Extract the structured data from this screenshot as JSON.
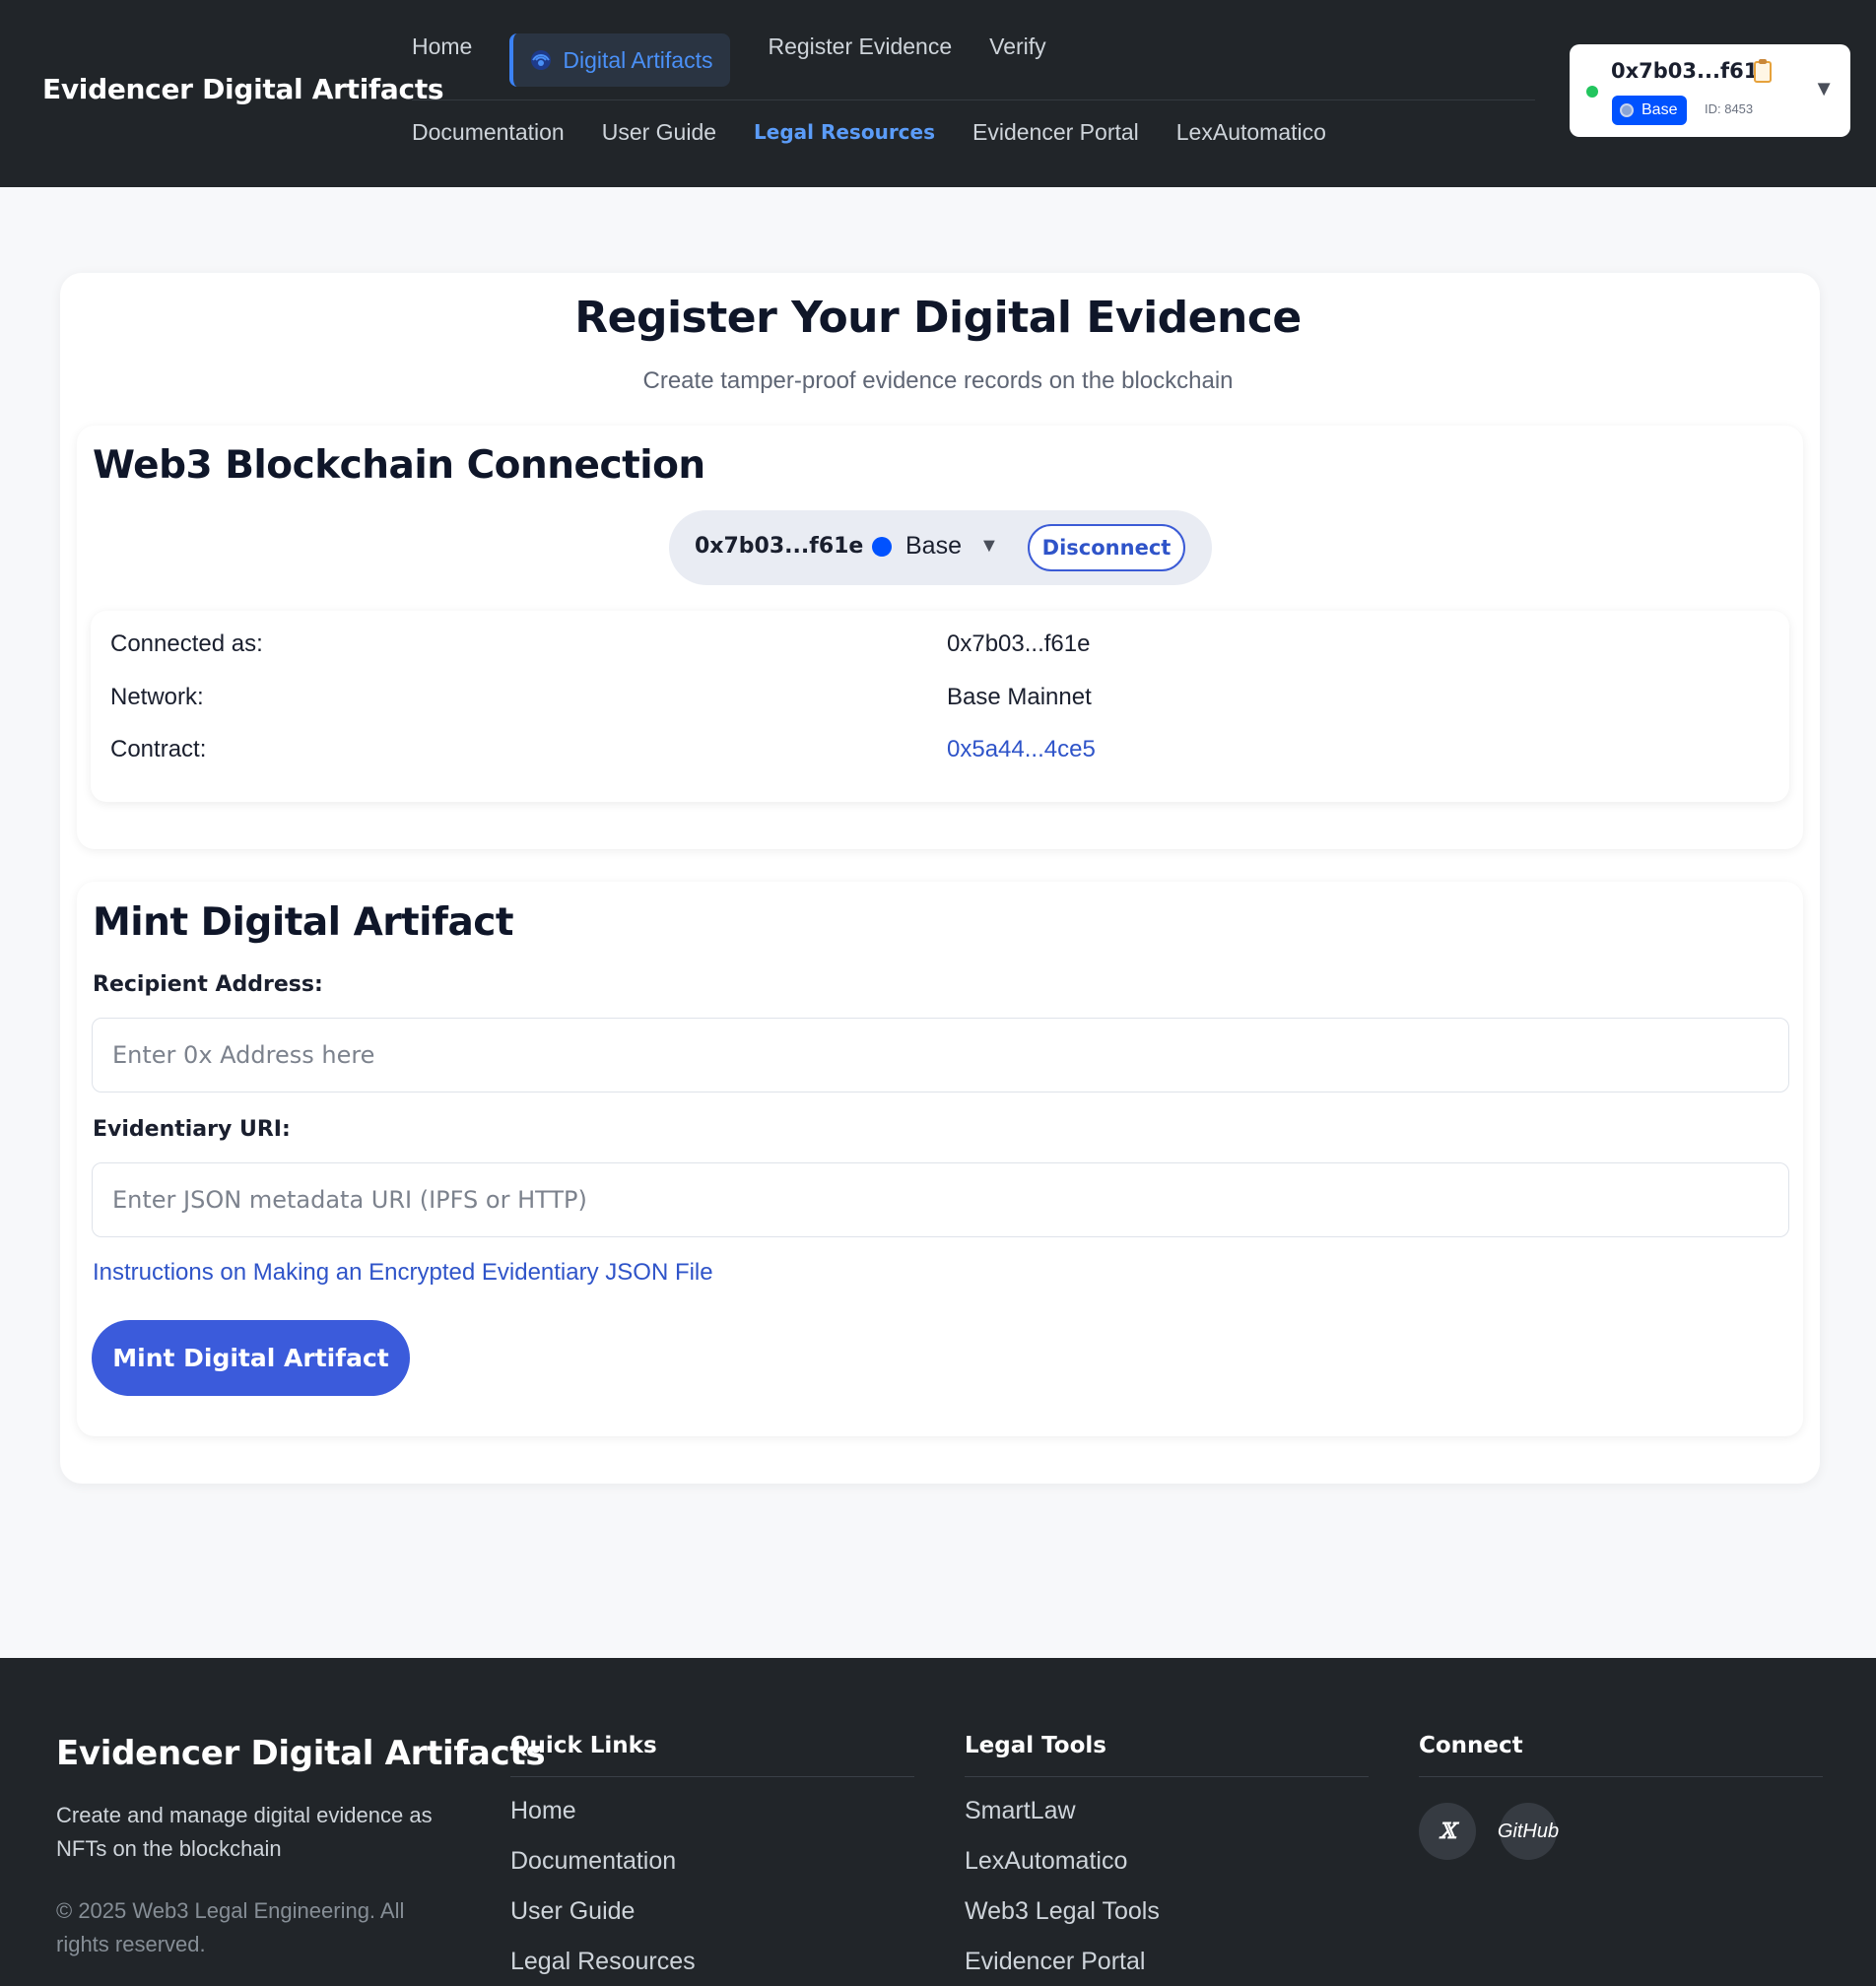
{
  "header": {
    "brand": "Evidencer Digital Artifacts",
    "nav_primary": [
      {
        "label": "Home"
      },
      {
        "label": "Digital Artifacts",
        "icon": "eye-icon",
        "active": true
      },
      {
        "label": "Register Evidence"
      },
      {
        "label": "Verify"
      }
    ],
    "nav_secondary": [
      {
        "label": "Documentation"
      },
      {
        "label": "User Guide"
      },
      {
        "label": "Legal Resources",
        "highlight": true
      },
      {
        "label": "Evidencer Portal"
      },
      {
        "label": "LexAutomatico"
      }
    ],
    "wallet": {
      "address": "0x7b03...f61e",
      "network": "Base",
      "chain_id": "ID: 8453",
      "status": "connected",
      "status_color": "#22c55e"
    }
  },
  "main": {
    "title": "Register Your Digital Evidence",
    "subtitle": "Create tamper-proof evidence records on the blockchain",
    "connection": {
      "title": "Web3 Blockchain Connection",
      "pill": {
        "address": "0x7b03...f61e",
        "network": "Base",
        "network_color": "#0052ff",
        "disconnect_label": "Disconnect"
      },
      "info": {
        "connected_label": "Connected as:",
        "connected_value": "0x7b03...f61e",
        "network_label": "Network:",
        "network_value": "Base Mainnet",
        "contract_label": "Contract:",
        "contract_value": "0x5a44...4ce5"
      }
    },
    "mint": {
      "title": "Mint Digital Artifact",
      "recipient_label": "Recipient Address:",
      "recipient_placeholder": "Enter 0x Address here",
      "recipient_value": "",
      "uri_label": "Evidentiary URI:",
      "uri_placeholder": "Enter JSON metadata URI (IPFS or HTTP)",
      "uri_value": "",
      "instructions_link": "Instructions on Making an Encrypted Evidentiary JSON File",
      "button_label": "Mint Digital Artifact"
    }
  },
  "footer": {
    "brand": "Evidencer Digital Artifacts",
    "description": "Create and manage digital evidence as NFTs on the blockchain",
    "copyright": "© 2025 Web3 Legal Engineering. All rights reserved.",
    "quick_links": {
      "title": "Quick Links",
      "items": [
        "Home",
        "Documentation",
        "User Guide",
        "Legal Resources"
      ]
    },
    "legal_tools": {
      "title": "Legal Tools",
      "items": [
        "SmartLaw",
        "LexAutomatico",
        "Web3 Legal Tools",
        "Evidencer Portal"
      ]
    },
    "connect": {
      "title": "Connect",
      "x_label": "𝕏",
      "github_label": "GitHub"
    }
  },
  "colors": {
    "header_bg": "#212529",
    "accent": "#3b5bdb",
    "link": "#2f54c9",
    "base_blue": "#0052ff"
  }
}
